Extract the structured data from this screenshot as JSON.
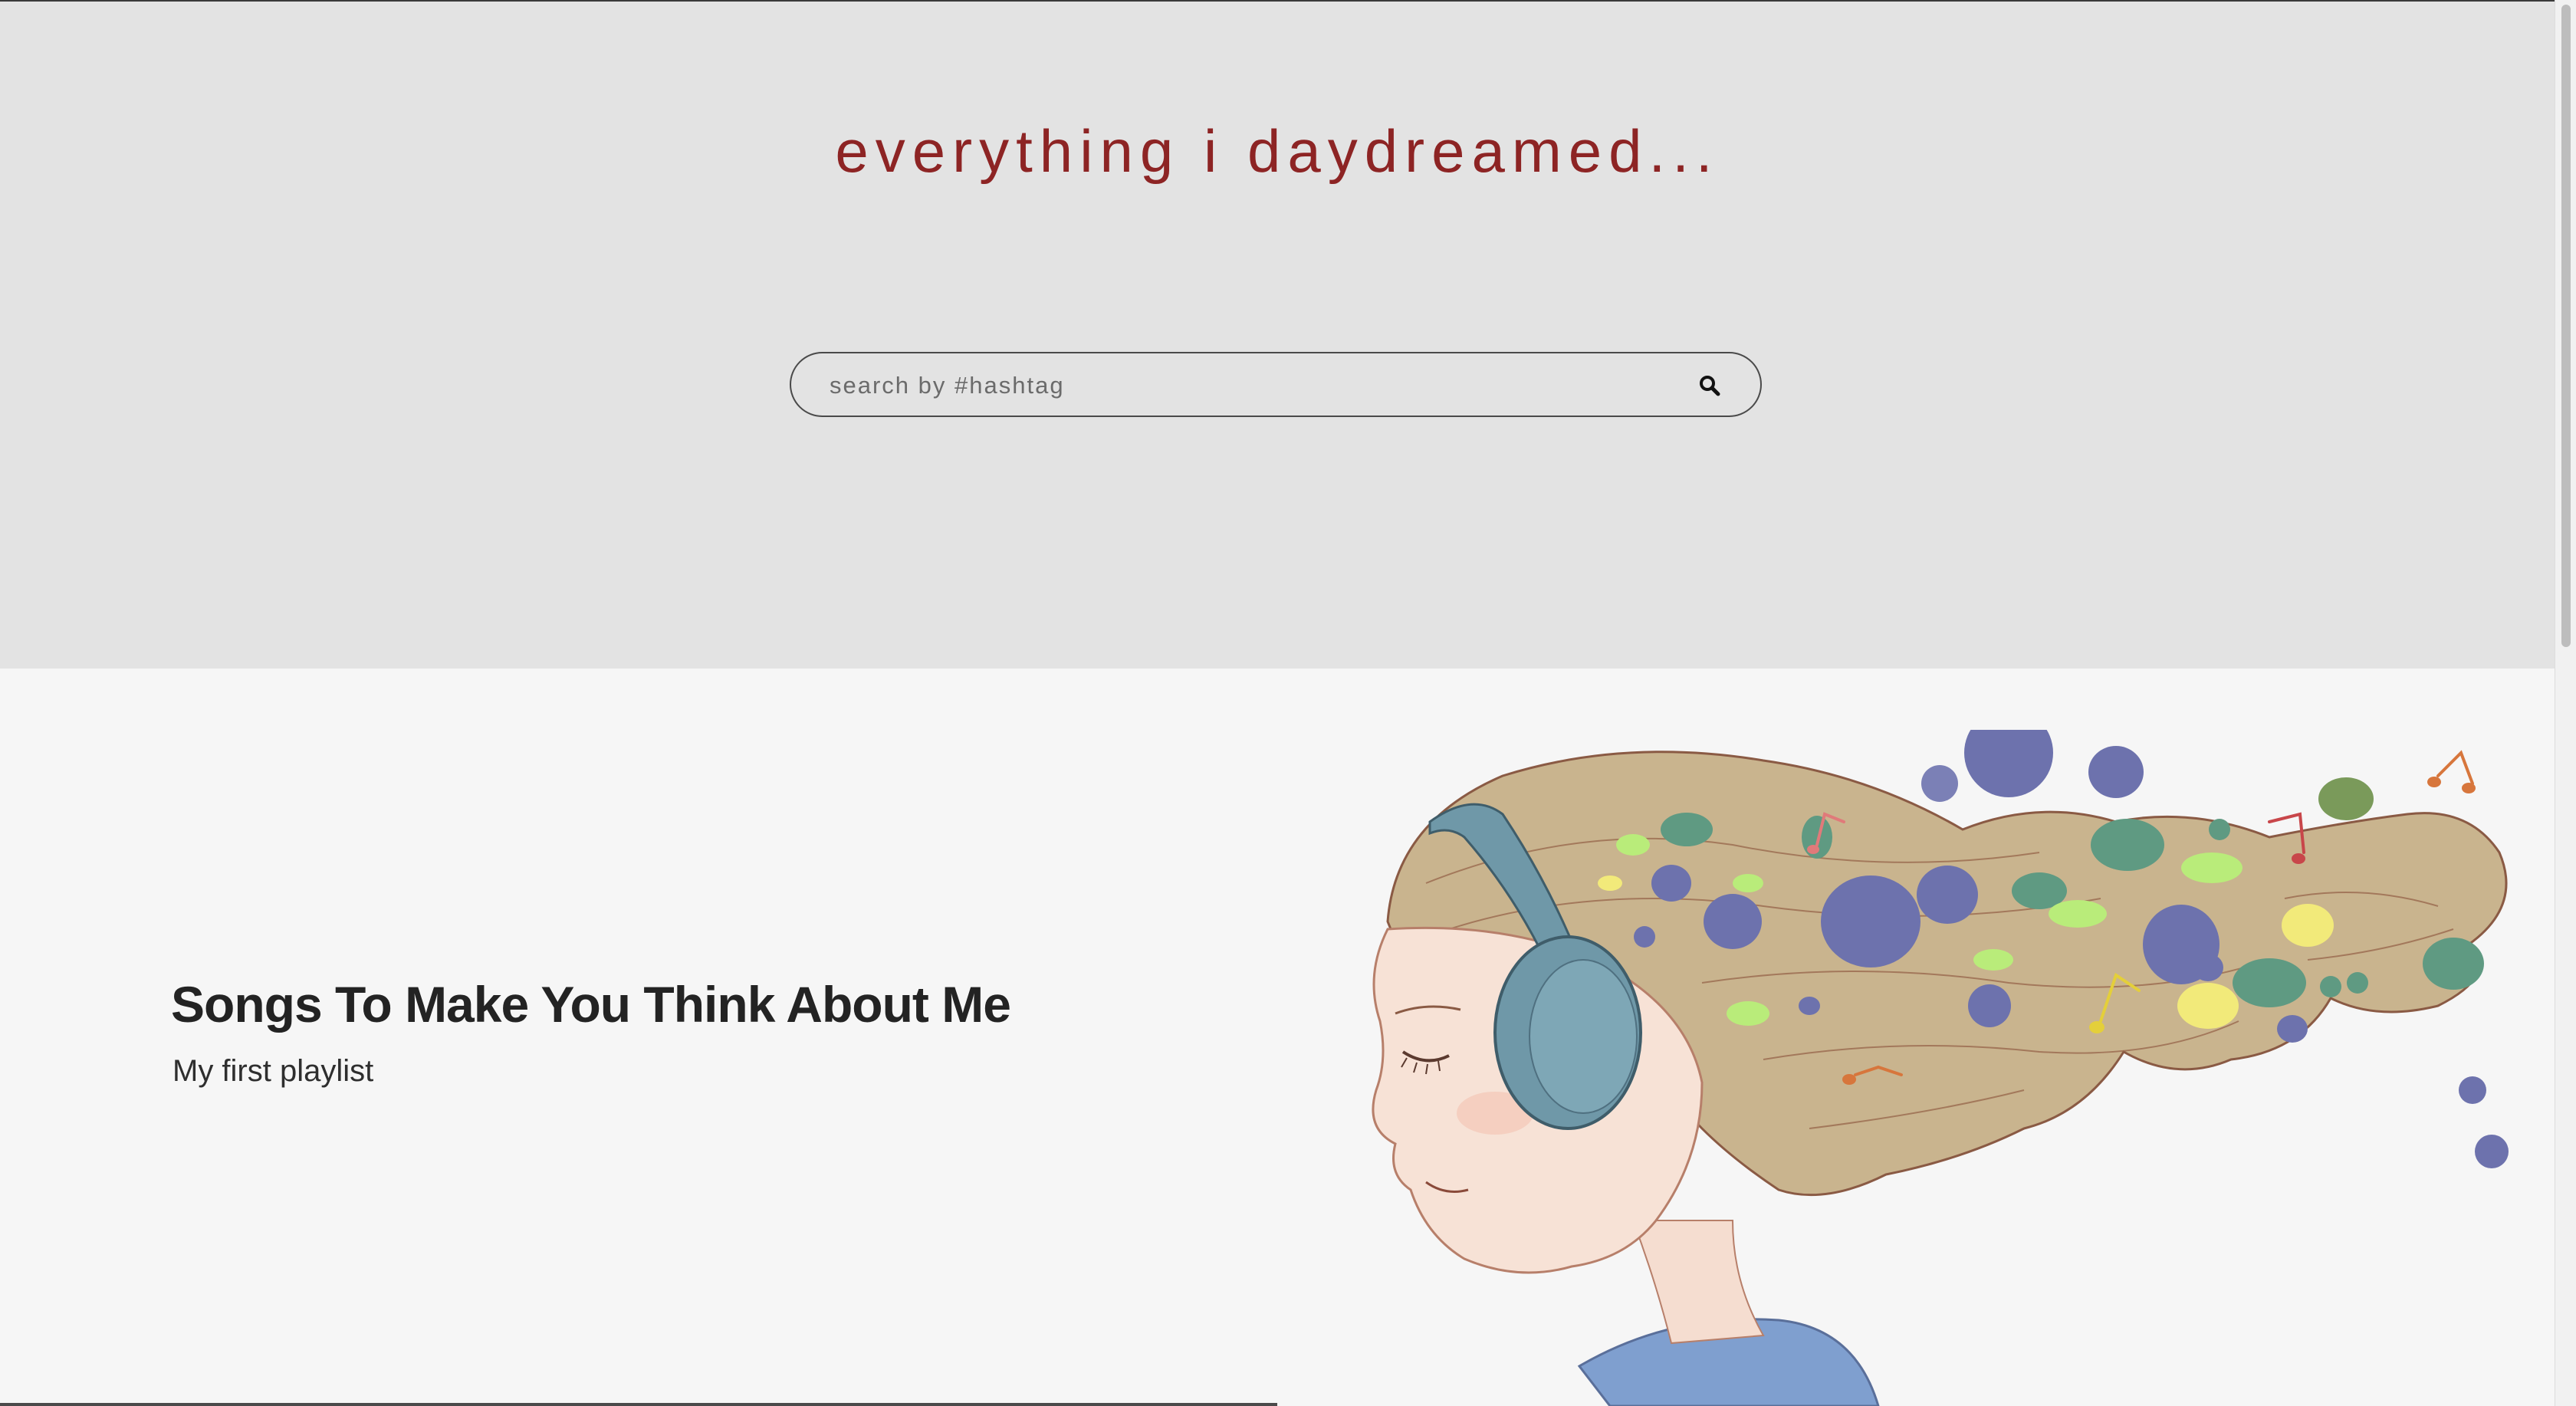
{
  "site": {
    "title": "everything i daydreamed..."
  },
  "search": {
    "placeholder": "search by #hashtag",
    "value": "",
    "icon": "search-icon"
  },
  "playlist": {
    "title": "Songs To Make You Think About Me",
    "subtitle": "My first playlist",
    "image_icon": "girl-with-headphones-illustration"
  },
  "colors": {
    "title": "#8d2424",
    "hero_background": "#e3e3e3",
    "content_background": "#f6f6f6",
    "headphones": "#6f98a8",
    "hair": "#c4b08a"
  }
}
